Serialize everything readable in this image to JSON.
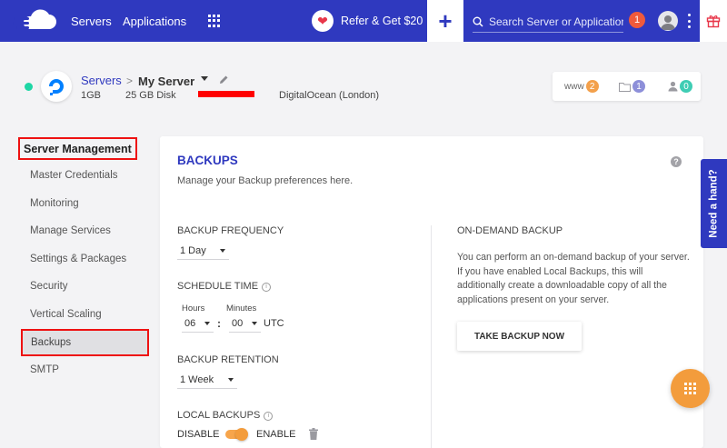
{
  "nav": {
    "servers": "Servers",
    "applications": "Applications",
    "refer": "Refer & Get $20",
    "plus": "+",
    "search_placeholder": "Search Server or Application",
    "notification_count": "1"
  },
  "server": {
    "breadcrumb_root": "Servers",
    "breadcrumb_sep": ">",
    "name": "My Server",
    "ram": "1GB",
    "disk": "25 GB Disk",
    "provider": "DigitalOcean (London)",
    "status_color": "#1ed6a5",
    "stats": {
      "www_label": "www",
      "www_count": "2",
      "files_count": "1",
      "users_count": "0"
    }
  },
  "sidebar": {
    "title": "Server Management",
    "items": [
      "Master Credentials",
      "Monitoring",
      "Manage Services",
      "Settings & Packages",
      "Security",
      "Vertical Scaling",
      "Backups",
      "SMTP"
    ],
    "active": "Backups"
  },
  "backups": {
    "title": "BACKUPS",
    "subtitle": "Manage your Backup preferences here.",
    "frequency_label": "BACKUP FREQUENCY",
    "frequency_value": "1 Day",
    "schedule_label": "SCHEDULE TIME",
    "hours_label": "Hours",
    "minutes_label": "Minutes",
    "hours_value": "06",
    "minutes_value": "00",
    "colon": ":",
    "timezone": "UTC",
    "retention_label": "BACKUP RETENTION",
    "retention_value": "1 Week",
    "local_label": "LOCAL BACKUPS",
    "disable_label": "DISABLE",
    "enable_label": "ENABLE",
    "local_enabled": true,
    "ondemand_title": "ON-DEMAND BACKUP",
    "ondemand_text": "You can perform an on-demand backup of your server. If you have enabled Local Backups, this will additionally create a downloadable copy of all the applications present on your server.",
    "ondemand_button": "TAKE BACKUP NOW"
  },
  "help": {
    "need_hand": "Need a hand?"
  },
  "colors": {
    "brand": "#2f39bf",
    "accent": "#f39c3c",
    "highlight_border": "#ee1111"
  }
}
